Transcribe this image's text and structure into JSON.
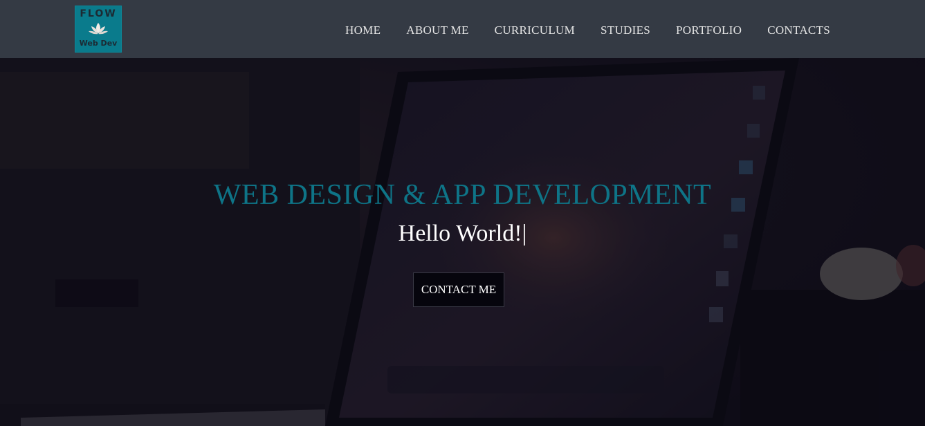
{
  "brand": {
    "logo_top": "FLOW",
    "logo_bottom": "Web Dev",
    "logo_color": "#0a7b8c"
  },
  "nav": {
    "items": [
      {
        "label": "HOME"
      },
      {
        "label": "ABOUT ME"
      },
      {
        "label": "CURRICULUM"
      },
      {
        "label": "STUDIES"
      },
      {
        "label": "PORTFOLIO"
      },
      {
        "label": "CONTACTS"
      }
    ]
  },
  "hero": {
    "title": "WEB DESIGN & APP DEVELOPMENT",
    "subtitle": "Hello World!",
    "cursor": "|",
    "cta_label": "CONTACT ME",
    "accent_color": "#0e7487",
    "background_image": "laptop-on-desk-icon"
  }
}
